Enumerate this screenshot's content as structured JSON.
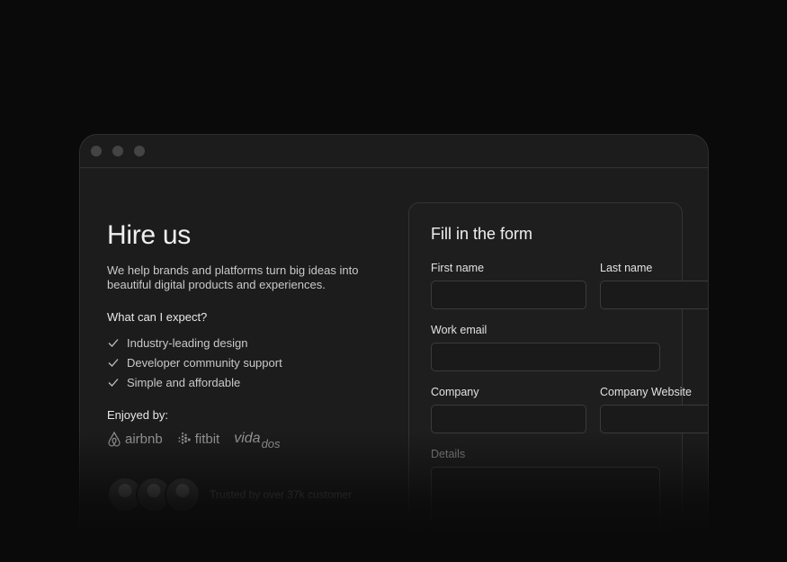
{
  "hero": {
    "title": "Hire us",
    "lead": "We help brands and platforms turn big ideas into beautiful digital products and experiences.",
    "expect_heading": "What can I expect?",
    "expectations": [
      "Industry-leading design",
      "Developer community support",
      "Simple and affordable"
    ],
    "enjoyed_heading": "Enjoyed by:",
    "logos": {
      "airbnb": "airbnb",
      "fitbit": "fitbit",
      "vida_main": "vida",
      "vida_sub": "dos"
    },
    "trusted_text": "Trusted by over 37k customer"
  },
  "form": {
    "title": "Fill in the form",
    "first_name_label": "First name",
    "first_name_value": "",
    "last_name_label": "Last name",
    "last_name_value": "",
    "email_label": "Work email",
    "email_value": "",
    "company_label": "Company",
    "company_value": "",
    "website_label": "Company Website",
    "website_value": "",
    "details_label": "Details",
    "details_value": ""
  },
  "icons": [
    "check-icon",
    "airbnb-logo-icon",
    "fitbit-logo-icon"
  ],
  "colors": {
    "background": "#0a0a0a",
    "window": "#1c1c1c",
    "border": "#2f2f2f"
  }
}
